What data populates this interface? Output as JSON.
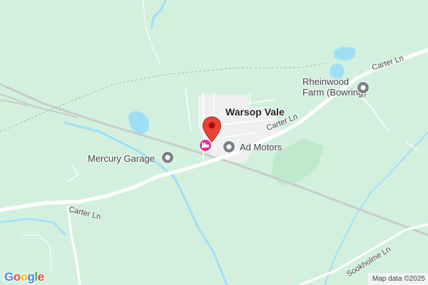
{
  "map": {
    "town_label": "Warsop Vale",
    "pois": [
      {
        "name": "Rheinwood Farm (Bowring)",
        "line1": "Rheinwood",
        "line2": "Farm (Bowring)",
        "icon": "poi-pin-icon"
      },
      {
        "name": "Ad Motors",
        "icon": "poi-pin-icon"
      },
      {
        "name": "Mercury Garage",
        "icon": "poi-pin-icon"
      }
    ],
    "roads": {
      "carter_ln_1": "Carter Ln",
      "carter_ln_2": "Carter Ln",
      "carter_ln_3": "Carter Ln",
      "sookholme_ln": "Sookholme Ln"
    },
    "marker": {
      "color": "#ea4335",
      "icon": "location-marker-icon"
    },
    "hotel_icon": {
      "color": "#e62e9a",
      "icon": "hotel-bed-icon"
    },
    "logo_text": "Google",
    "attribution": "Map data ©2025",
    "colors": {
      "land": "#d3f0de",
      "water": "#9fdff5",
      "built_up": "#f1f3f4",
      "park": "#b9e6c9",
      "road": "#ffffff"
    }
  }
}
